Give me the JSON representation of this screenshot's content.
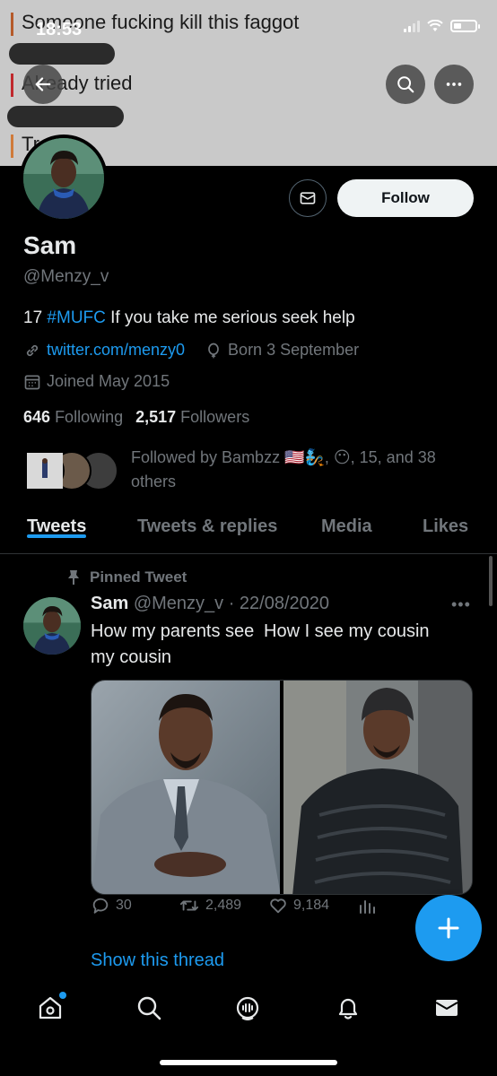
{
  "status_bar": {
    "time": "18:53"
  },
  "banner": {
    "line1": "Someone fucking kill this faggot",
    "line2": "Already tried",
    "line3": "Tr...der"
  },
  "profile": {
    "name": "Sam",
    "handle": "@Menzy_v",
    "bio_prefix": "17 ",
    "bio_hashtag": "#MUFC",
    "bio_suffix": " If you take me serious seek help",
    "website": "twitter.com/menzy0",
    "birthday": "Born 3 September",
    "joined": "Joined May 2015",
    "following_count": "646",
    "following_label": "Following",
    "followers_count": "2,517",
    "followers_label": "Followers",
    "followed_by": "Followed by Bambzz 🇺🇸🧞, 😶, 15, and 38 others",
    "follow_button": "Follow"
  },
  "tabs": [
    {
      "label": "Tweets",
      "active": true
    },
    {
      "label": "Tweets & replies",
      "active": false
    },
    {
      "label": "Media",
      "active": false
    },
    {
      "label": "Likes",
      "active": false
    }
  ],
  "tweet": {
    "pinned_label": "Pinned Tweet",
    "author_name": "Sam",
    "author_handle_date": "@Menzy_v · 22/08/2020",
    "caption_left": "How my parents see my cousin",
    "caption_right": "How I see my cousin",
    "replies": "30",
    "retweets": "2,489",
    "likes": "9,184",
    "show_thread": "Show this thread"
  },
  "icons": {
    "back": "arrow-left-icon",
    "search": "search-icon",
    "more": "more-horizontal-icon",
    "mail": "mail-icon",
    "link": "link-icon",
    "balloon": "balloon-icon",
    "calendar": "calendar-icon",
    "pin": "pin-icon",
    "reply": "reply-icon",
    "retweet": "retweet-icon",
    "like": "heart-icon",
    "analytics": "analytics-icon",
    "compose": "plus-icon",
    "nav": [
      "home-icon",
      "search-icon",
      "spaces-icon",
      "bell-icon",
      "mail-icon"
    ]
  },
  "colors": {
    "accent": "#1d9bf0",
    "muted": "#71767b",
    "text": "#e7e9ea",
    "background": "#000000"
  }
}
